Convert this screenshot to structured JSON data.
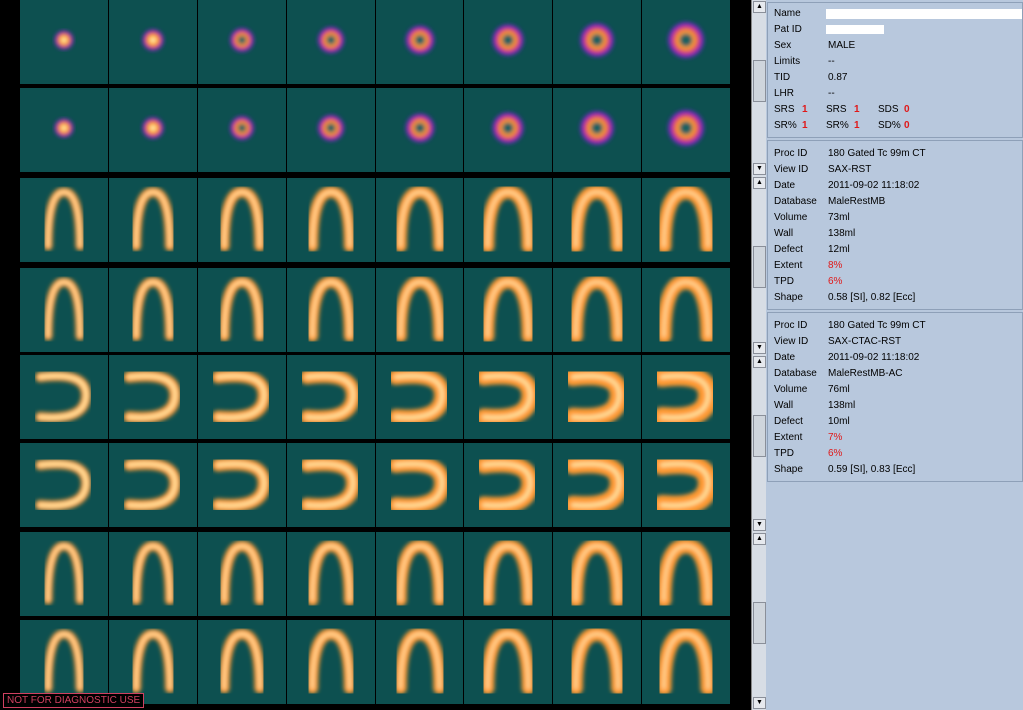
{
  "footer": {
    "warning": "NOT FOR DIAGNOSTIC USE"
  },
  "patient": {
    "name_label": "Name",
    "patid_label": "Pat ID",
    "sex_label": "Sex",
    "sex": "MALE",
    "limits_label": "Limits",
    "limits": "--",
    "tid_label": "TID",
    "tid": "0.87",
    "lhr_label": "LHR",
    "lhr": "--",
    "srs_label": "SRS",
    "srs1": "1",
    "srs2": "1",
    "sds_label": "SDS",
    "sds": "0",
    "srp_label": "SR%",
    "srp1": "1",
    "srp2": "1",
    "sdp_label": "SD%",
    "sdp": "0"
  },
  "study1": {
    "proc_label": "Proc ID",
    "proc": "180 Gated Tc 99m CT",
    "view_label": "View ID",
    "view": "SAX-RST",
    "date_label": "Date",
    "date": "2011-09-02 11:18:02",
    "db_label": "Database",
    "db": "MaleRestMB",
    "volume_label": "Volume",
    "volume": "73ml",
    "wall_label": "Wall",
    "wall": "138ml",
    "defect_label": "Defect",
    "defect": "12ml",
    "extent_label": "Extent",
    "extent": "8%",
    "tpd_label": "TPD",
    "tpd": "6%",
    "shape_label": "Shape",
    "shape": "0.58 [SI], 0.82 [Ecc]"
  },
  "study2": {
    "proc_label": "Proc ID",
    "proc": "180 Gated Tc 99m CT",
    "view_label": "View ID",
    "view": "SAX-CTAC-RST",
    "date_label": "Date",
    "date": "2011-09-02 11:18:02",
    "db_label": "Database",
    "db": "MaleRestMB-AC",
    "volume_label": "Volume",
    "volume": "76ml",
    "wall_label": "Wall",
    "wall": "138ml",
    "defect_label": "Defect",
    "defect": "10ml",
    "extent_label": "Extent",
    "extent": "7%",
    "tpd_label": "TPD",
    "tpd": "6%",
    "shape_label": "Shape",
    "shape": "0.59 [SI], 0.83 [Ecc]"
  },
  "scroll": {
    "up": "▲",
    "down": "▼"
  },
  "views": [
    "short-axis",
    "short-axis",
    "vertical-long-axis",
    "vertical-long-axis",
    "horizontal-long-axis",
    "horizontal-long-axis",
    "vertical-long-axis",
    "vertical-long-axis"
  ],
  "colors": {
    "background": "#0d5050",
    "panel": "#b8c8dd",
    "warning": "#d04060",
    "emphasis": "#e01818"
  }
}
